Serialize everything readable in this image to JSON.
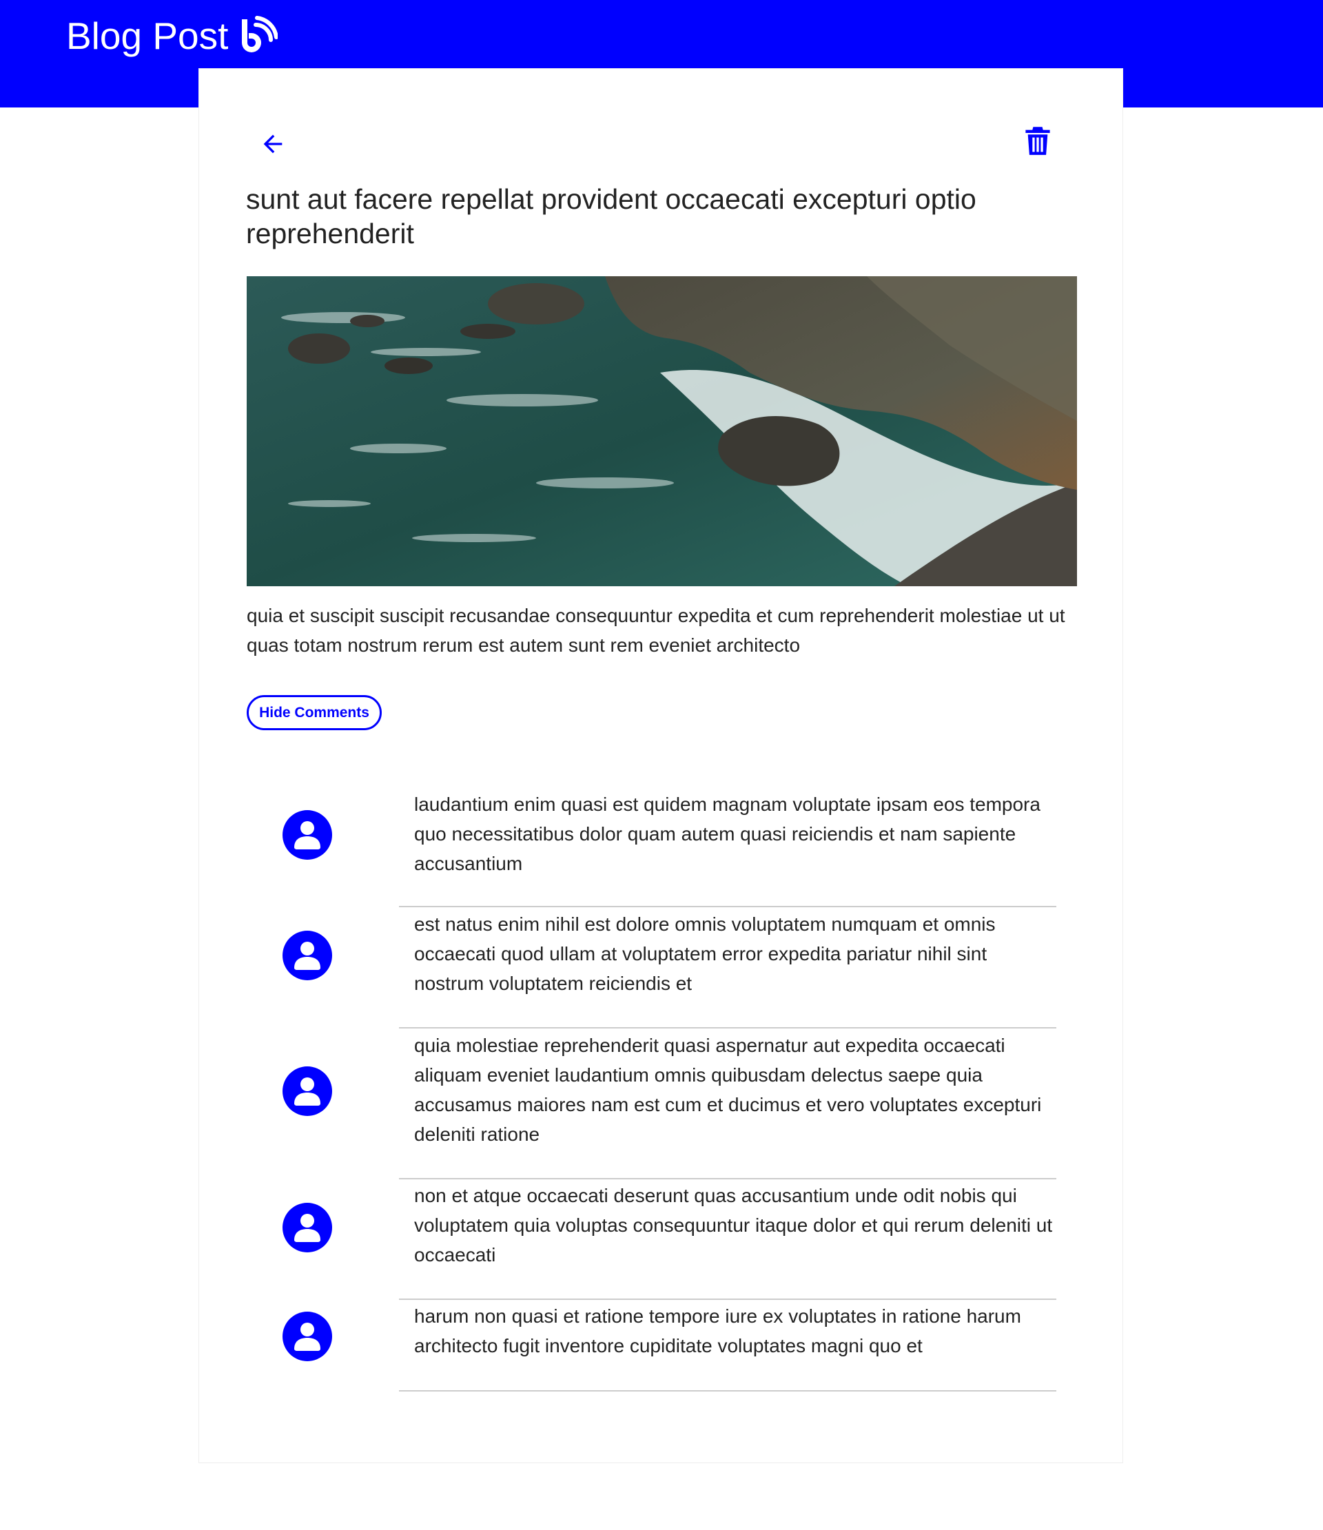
{
  "app_bar": {
    "title": "Blog Post",
    "icon": "feed-icon",
    "color": "#0000ff"
  },
  "post": {
    "back_icon": "arrow-left-icon",
    "delete_icon": "trash-icon",
    "title": "sunt aut facere repellat provident occaecati excepturi optio reprehenderit",
    "image_alt": "coastal rocks and ocean waves",
    "body": "quia et suscipit suscipit recusandae consequuntur expedita et cum reprehenderit molestiae ut ut quas totam nostrum rerum est autem sunt rem eveniet architecto",
    "toggle_comments_label": "Hide Comments"
  },
  "comments": [
    {
      "avatar_icon": "user-circle-icon",
      "body": "laudantium enim quasi est quidem magnam voluptate ipsam eos tempora quo necessitatibus dolor quam autem quasi reiciendis et nam sapiente accusantium"
    },
    {
      "avatar_icon": "user-circle-icon",
      "body": "est natus enim nihil est dolore omnis voluptatem numquam et omnis occaecati quod ullam at voluptatem error expedita pariatur nihil sint nostrum voluptatem reiciendis et"
    },
    {
      "avatar_icon": "user-circle-icon",
      "body": "quia molestiae reprehenderit quasi aspernatur aut expedita occaecati aliquam eveniet laudantium omnis quibusdam delectus saepe quia accusamus maiores nam est cum et ducimus et vero voluptates excepturi deleniti ratione"
    },
    {
      "avatar_icon": "user-circle-icon",
      "body": "non et atque occaecati deserunt quas accusantium unde odit nobis qui voluptatem quia voluptas consequuntur itaque dolor et qui rerum deleniti ut occaecati"
    },
    {
      "avatar_icon": "user-circle-icon",
      "body": "harum non quasi et ratione tempore iure ex voluptates in ratione harum architecto fugit inventore cupiditate voluptates magni quo et"
    }
  ]
}
